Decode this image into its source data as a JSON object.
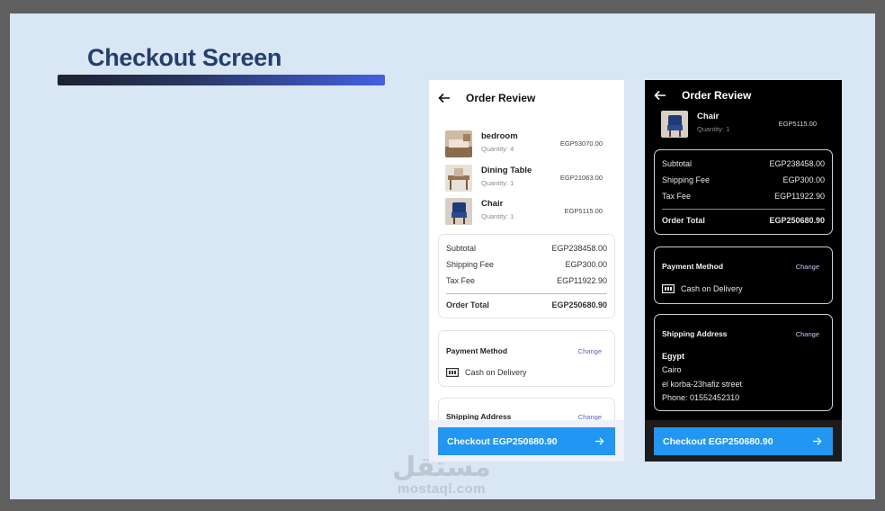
{
  "slide": {
    "title": "Checkout Screen"
  },
  "light": {
    "header_title": "Order Review",
    "items": [
      {
        "name": "bedroom",
        "quantity": "Quantity: 4",
        "price": "EGP53070.00"
      },
      {
        "name": "Dining Table",
        "quantity": "Quantity: 1",
        "price": "EGP21063.00"
      },
      {
        "name": "Chair",
        "quantity": "Quantity: 1",
        "price": "EGP5115.00"
      }
    ],
    "summary": {
      "subtotal_label": "Subtotal",
      "subtotal": "EGP238458.00",
      "shipping_label": "Shipping Fee",
      "shipping": "EGP300.00",
      "tax_label": "Tax Fee",
      "tax": "EGP11922.90",
      "total_label": "Order Total",
      "total": "EGP250680.90"
    },
    "payment": {
      "title": "Payment Method",
      "change": "Change",
      "method": "Cash on Delivery"
    },
    "shipping": {
      "title": "Shipping Address",
      "change": "Change"
    },
    "checkout": "Checkout EGP250680.90"
  },
  "dark": {
    "header_title": "Order Review",
    "item": {
      "name": "Chair",
      "quantity": "Quantity: 1",
      "price": "EGP5115.00"
    },
    "summary": {
      "subtotal_label": "Subtotal",
      "subtotal": "EGP238458.00",
      "shipping_label": "Shipping Fee",
      "shipping": "EGP300.00",
      "tax_label": "Tax Fee",
      "tax": "EGP11922.90",
      "total_label": "Order Total",
      "total": "EGP250680.90"
    },
    "payment": {
      "title": "Payment Method",
      "change": "Change",
      "method": "Cash on Delivery"
    },
    "shipping": {
      "title": "Shipping Address",
      "change": "Change",
      "country": "Egypt",
      "city": "Cairo",
      "street": "el korba-23hafiz street",
      "phone": "Phone: 01552452310"
    },
    "checkout": "Checkout EGP250680.90"
  },
  "watermark": {
    "logo": "مستقل",
    "text": "mostaql.com"
  },
  "colors": {
    "accent": "#2196f3",
    "slide_bg": "#d9e6f4",
    "title": "#243e6d"
  },
  "icons": [
    "arrow-left-icon",
    "cash-icon",
    "arrow-right-icon"
  ]
}
